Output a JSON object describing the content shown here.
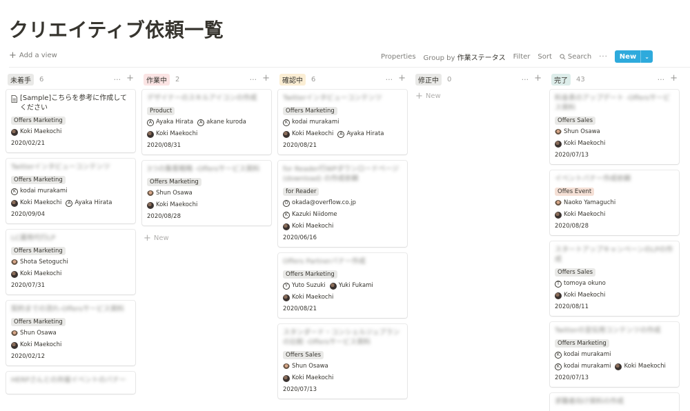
{
  "page": {
    "title": "クリエイティブ依頼一覧"
  },
  "toolbar": {
    "add_view": "Add a view",
    "properties": "Properties",
    "group_by_prefix": "Group by",
    "group_by_value": "作業ステータス",
    "filter": "Filter",
    "sort": "Sort",
    "search": "Search",
    "more": "···",
    "new_button": "New",
    "new_caret": "⌄",
    "accent_color": "#2eaadc"
  },
  "columns": [
    {
      "name": "未着手",
      "count": "6",
      "color": "#e9e9e7",
      "cards": [
        {
          "title": "[Sample]こちらを参考に作成してください",
          "blurred": false,
          "tag": "Offers Marketing",
          "people_rows": [
            [
              {
                "name": "Koki Maekochi",
                "avatar": "photo"
              }
            ]
          ],
          "date": "2020/02/21"
        },
        {
          "title": "Twitterインタビューコンテンツ",
          "blurred": true,
          "tag": "Offers Marketing",
          "people_rows": [
            [
              {
                "name": "kodai murakami",
                "avatar": "K"
              }
            ],
            [
              {
                "name": "Koki Maekochi",
                "avatar": "photo"
              },
              {
                "name": "Ayaka Hirata",
                "avatar": "A"
              }
            ]
          ],
          "date": "2020/09/04"
        },
        {
          "title": "LC運用代行LP",
          "blurred": true,
          "tag": "Offers Marketing",
          "people_rows": [
            [
              {
                "name": "Shota Setoguchi",
                "avatar": "icon"
              }
            ],
            [
              {
                "name": "Koki Maekochi",
                "avatar": "photo"
              }
            ]
          ],
          "date": "2020/07/31"
        },
        {
          "title": "契約までの流れ-Offersサービス資料",
          "blurred": true,
          "tag": "Offers Marketing",
          "people_rows": [
            [
              {
                "name": "Shun Osawa",
                "avatar": "icon"
              }
            ],
            [
              {
                "name": "Koki Maekochi",
                "avatar": "photo"
              }
            ]
          ],
          "date": "2020/02/12"
        },
        {
          "title": "HERPさんとの共催イベントのバナー",
          "blurred": true,
          "tag": "",
          "people_rows": [],
          "date": ""
        }
      ],
      "show_new": false
    },
    {
      "name": "作業中",
      "count": "2",
      "color": "#fbe4e4",
      "cards": [
        {
          "title": "デザイナーのスキルアイコンの作成",
          "blurred": true,
          "tag": "Product",
          "people_rows": [
            [
              {
                "name": "Ayaka Hirata",
                "avatar": "A"
              },
              {
                "name": "akane kuroda",
                "avatar": "A"
              }
            ],
            [
              {
                "name": "Koki Maekochi",
                "avatar": "photo"
              }
            ]
          ],
          "date": "2020/08/31"
        },
        {
          "title": "3つの集客戦略 -Offersサービス資料",
          "blurred": true,
          "tag": "Offers Marketing",
          "people_rows": [
            [
              {
                "name": "Shun Osawa",
                "avatar": "icon"
              }
            ],
            [
              {
                "name": "Koki Maekochi",
                "avatar": "photo"
              }
            ]
          ],
          "date": "2020/08/28"
        }
      ],
      "show_new": true
    },
    {
      "name": "確認中",
      "count": "6",
      "color": "#fbeed4",
      "cards": [
        {
          "title": "Twitterインタビューコンテンツ",
          "blurred": true,
          "tag": "Offers Marketing",
          "people_rows": [
            [
              {
                "name": "kodai murakami",
                "avatar": "K"
              }
            ],
            [
              {
                "name": "Koki Maekochi",
                "avatar": "photo"
              },
              {
                "name": "Ayaka Hirata",
                "avatar": "A"
              }
            ]
          ],
          "date": "2020/08/21"
        },
        {
          "title": "for Reader行WPダウンロードページ (download) の作成依頼",
          "blurred": true,
          "tag": "for Reader",
          "people_rows": [
            [
              {
                "name": "okada@overflow.co.jp",
                "avatar": "O"
              }
            ],
            [
              {
                "name": "Kazuki Niidome",
                "avatar": "K"
              }
            ],
            [
              {
                "name": "Koki Maekochi",
                "avatar": "photo"
              }
            ]
          ],
          "date": "2020/06/16"
        },
        {
          "title": "Offers Partnerバナー作成",
          "blurred": true,
          "tag": "Offers Marketing",
          "people_rows": [
            [
              {
                "name": "Yuto Suzuki",
                "avatar": "Y"
              },
              {
                "name": "Yuki Fukami",
                "avatar": "photo"
              }
            ],
            [
              {
                "name": "Koki Maekochi",
                "avatar": "photo"
              }
            ]
          ],
          "date": "2020/08/21"
        },
        {
          "title": "スタンダード・コンシェルジュプランの比較 -Offersサービス資料",
          "blurred": true,
          "tag": "Offers Sales",
          "people_rows": [
            [
              {
                "name": "Shun Osawa",
                "avatar": "icon"
              }
            ],
            [
              {
                "name": "Koki Maekochi",
                "avatar": "photo"
              }
            ]
          ],
          "date": "2020/07/13"
        }
      ],
      "show_new": false
    },
    {
      "name": "修正中",
      "count": "0",
      "color": "#e9e9e7",
      "cards": [],
      "show_new": true
    },
    {
      "name": "完了",
      "count": "43",
      "color": "#ddedea",
      "cards": [
        {
          "title": "料金表のアップデート -Offersサービス資料",
          "blurred": true,
          "tag": "Offers Sales",
          "people_rows": [
            [
              {
                "name": "Shun Osawa",
                "avatar": "icon"
              }
            ],
            [
              {
                "name": "Koki Maekochi",
                "avatar": "photo"
              }
            ]
          ],
          "date": "2020/07/13"
        },
        {
          "title": "イベントバナー作成依頼",
          "blurred": true,
          "tag": "Offes Event",
          "tag_event": true,
          "people_rows": [
            [
              {
                "name": "Naoko Yamaguchi",
                "avatar": "icon"
              }
            ],
            [
              {
                "name": "Koki Maekochi",
                "avatar": "photo"
              }
            ]
          ],
          "date": "2020/08/28"
        },
        {
          "title": "スタートアップキャンペーンのLPの作成",
          "blurred": true,
          "tag": "Offers Sales",
          "people_rows": [
            [
              {
                "name": "tomoya okuno",
                "avatar": "T"
              }
            ],
            [
              {
                "name": "Koki Maekochi",
                "avatar": "photo"
              }
            ]
          ],
          "date": "2020/08/11"
        },
        {
          "title": "Twitterの宣伝用コンテンツの作成",
          "blurred": true,
          "tag": "Offers Marketing",
          "people_rows": [
            [
              {
                "name": "kodai murakami",
                "avatar": "K"
              }
            ],
            [
              {
                "name": "kodai murakami",
                "avatar": "K"
              },
              {
                "name": "Koki Maekochi",
                "avatar": "photo"
              }
            ]
          ],
          "date": "2020/07/13"
        },
        {
          "title": "求職者向け資料の作成",
          "blurred": true,
          "tag": "",
          "people_rows": [],
          "date": ""
        }
      ],
      "show_new": false
    }
  ],
  "labels": {
    "new_row": "New",
    "column_more": "···",
    "column_add": "+"
  }
}
